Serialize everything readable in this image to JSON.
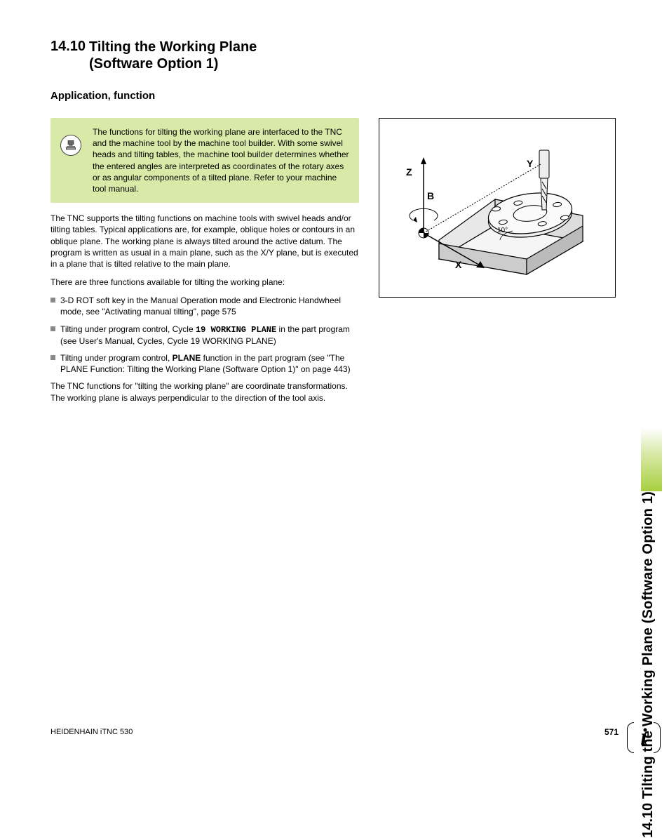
{
  "section": {
    "number": "14.10",
    "title": "Tilting the Working Plane (Software Option 1)"
  },
  "subheading": "Application, function",
  "note": "The functions for tilting the working plane are interfaced to the TNC and the machine tool by the machine tool builder. With some swivel heads and tilting tables, the machine tool builder determines whether the entered angles are interpreted as coordinates of the rotary axes or as angular components of a tilted plane. Refer to your machine tool manual.",
  "para1": "The TNC supports the tilting functions on machine tools with swivel heads and/or tilting tables. Typical applications are, for example, oblique holes or contours in an oblique plane. The working plane is always tilted around the active datum. The program is written as usual in a main plane, such as the X/Y plane, but is executed in a plane that is tilted relative to the main plane.",
  "para2": "There are three functions available for tilting the working plane:",
  "bullets": {
    "b1": "3-D ROT soft key in the Manual Operation mode and Electronic Handwheel mode, see \"Activating manual tilting\", page 575",
    "b2a": "Tilting under program control, Cycle ",
    "b2code": "19 WORKING PLANE",
    "b2b": " in the part program (see User's Manual, Cycles, Cycle 19 WORKING PLANE)",
    "b3a": "Tilting under program control, ",
    "b3bold": "PLANE",
    "b3b": " function in the part program (see \"The PLANE Function: Tilting the Working Plane (Software Option 1)\" on page 443)"
  },
  "para3": "The TNC functions for \"tilting the working plane\" are coordinate transformations. The working plane is always perpendicular to the direction of the tool axis.",
  "figure": {
    "z": "Z",
    "y": "Y",
    "b": "B",
    "x": "X",
    "angle": "10°"
  },
  "sidebar": {
    "number": "14.10",
    "title": "Tilting the Working Plane (Software Option 1)"
  },
  "footer": {
    "left": "HEIDENHAIN iTNC 530",
    "page": "571"
  }
}
